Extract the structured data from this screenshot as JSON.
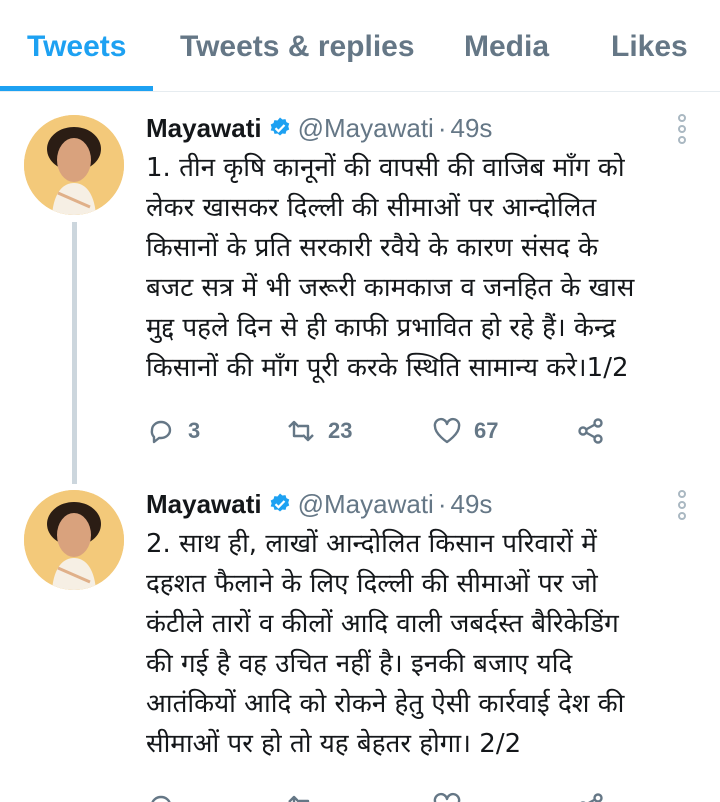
{
  "tabs": [
    {
      "label": "Tweets"
    },
    {
      "label": "Tweets & replies"
    },
    {
      "label": "Media"
    },
    {
      "label": "Likes"
    }
  ],
  "tweets": [
    {
      "name": "Mayawati",
      "handle": "@Mayawati",
      "time": "49s",
      "lines": [
        "1. तीन कृषि कानूनों की वापसी की वाजिब माँग को",
        "लेकर खासकर दिल्ली की सीमाओं पर आन्दोलित",
        "किसानों के प्रति सरकारी रवैये के कारण संसद के",
        "बजट सत्र में भी जरूरी कामकाज व जनहित के खास",
        "मुद्द पहले दिन से ही काफी प्रभावित हो रहे हैं। केन्द्र",
        "किसानों की माँग पूरी करके स्थिति सामान्य करे।1/2"
      ],
      "replies": "3",
      "retweets": "23",
      "likes": "67"
    },
    {
      "name": "Mayawati",
      "handle": "@Mayawati",
      "time": "49s",
      "lines": [
        "2. साथ ही, लाखों आन्दोलित किसान परिवारों में",
        "दहशत फैलाने के लिए दिल्ली की सीमाओं पर जो",
        "कंटीले तारों व कीलों आदि वाली जबर्दस्त बैरिकेडिंग",
        "की गई है वह उचित नहीं है। इनकी बजाए यदि",
        "आतंकियों आदि को रोकने हेतु ऐसी कार्रवाई देश की",
        "सीमाओं पर हो तो यह बेहतर होगा। 2/2"
      ],
      "replies": "",
      "retweets": "",
      "likes": ""
    }
  ],
  "colors": {
    "accent": "#1da1f2",
    "muted": "#657786",
    "text": "#14171a",
    "avatar_bg": "#f3c97a"
  },
  "icons": [
    "verified-badge-icon",
    "more-options-icon",
    "reply-icon",
    "retweet-icon",
    "like-icon",
    "share-icon"
  ]
}
